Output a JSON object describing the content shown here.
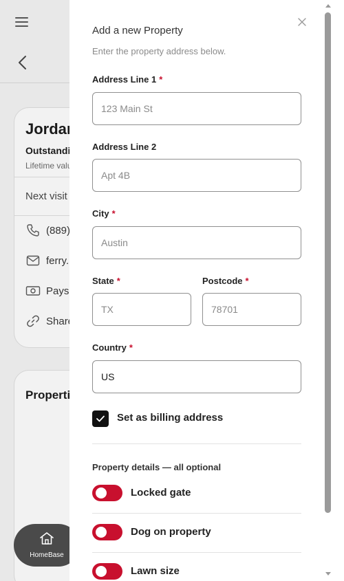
{
  "background": {
    "client": {
      "name": "Jordan",
      "outstanding_label": "Outstanding",
      "lifetime_label": "Lifetime value",
      "next_visit_label": "Next visit",
      "phone": "(889)",
      "email": "ferry.r",
      "pays_label": "Pays",
      "share_label": "Share"
    },
    "properties_title": "Properties",
    "homebase_label": "HomeBase"
  },
  "drawer": {
    "title": "Add a new Property",
    "subtitle": "Enter the property address below.",
    "fields": {
      "address1": {
        "label": "Address Line 1",
        "required_mark": "*",
        "placeholder": "123 Main St",
        "value": ""
      },
      "address2": {
        "label": "Address Line 2",
        "placeholder": "Apt 4B",
        "value": ""
      },
      "city": {
        "label": "City",
        "required_mark": "*",
        "placeholder": "Austin",
        "value": ""
      },
      "state": {
        "label": "State",
        "required_mark": "*",
        "placeholder": "TX",
        "value": ""
      },
      "postcode": {
        "label": "Postcode",
        "required_mark": "*",
        "placeholder": "78701",
        "value": ""
      },
      "country": {
        "label": "Country",
        "required_mark": "*",
        "placeholder": "",
        "value": "US"
      }
    },
    "billing_checkbox": {
      "label": "Set as billing address",
      "checked": true
    },
    "details_section_label": "Property details — all optional",
    "toggles": [
      {
        "label": "Locked gate",
        "on": false
      },
      {
        "label": "Dog on property",
        "on": false
      },
      {
        "label": "Lawn size",
        "on": false
      }
    ]
  },
  "colors": {
    "accent_red": "#c8102e",
    "checkbox_fill": "#111111",
    "homebase_bg": "#4a4a4a"
  }
}
